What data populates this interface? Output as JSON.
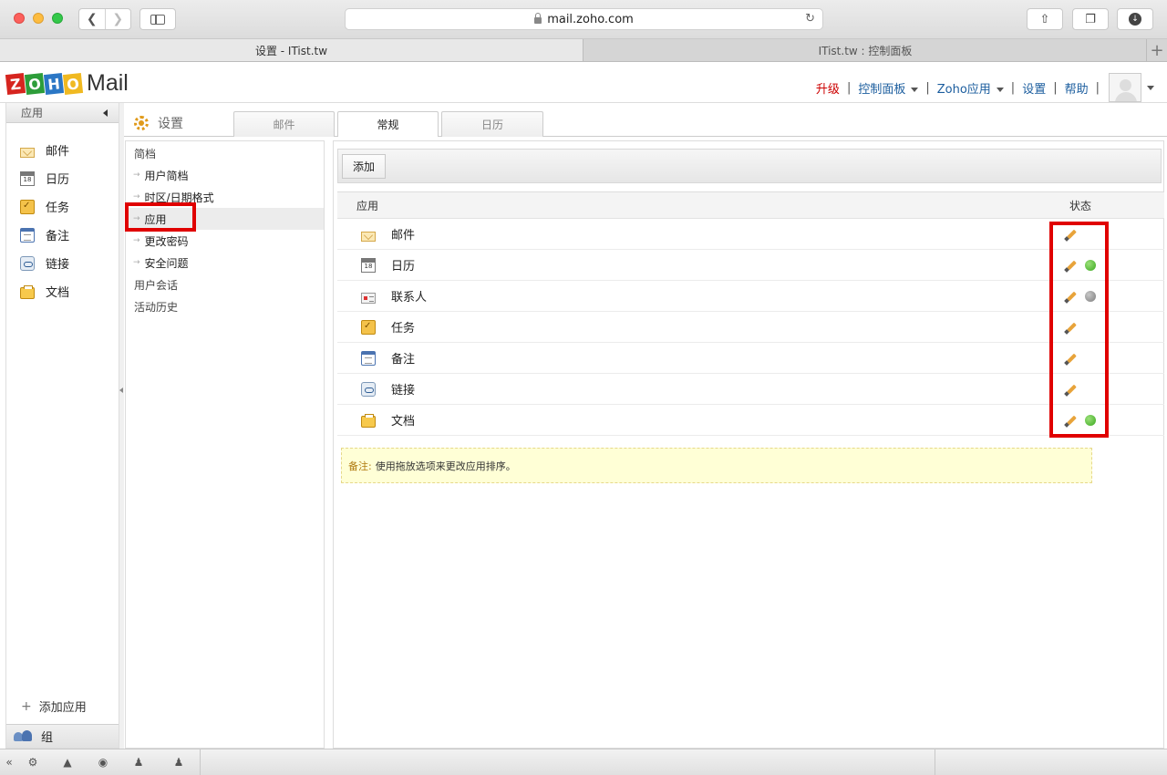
{
  "browser": {
    "url": "mail.zoho.com",
    "tabs": [
      {
        "label": "设置 - ITist.tw",
        "active": true
      },
      {
        "label": "ITist.tw : 控制面板",
        "active": false
      }
    ]
  },
  "header": {
    "logo_letters": [
      "Z",
      "O",
      "H",
      "O"
    ],
    "logo_colors": [
      "#d6251f",
      "#2d9d3a",
      "#2b77c5",
      "#f0b921"
    ],
    "logo_mail": "Mail",
    "nav": {
      "upgrade": "升级",
      "control_panel": "控制面板",
      "zoho_apps": "Zoho应用",
      "settings": "设置",
      "help": "帮助",
      "separator": "|"
    }
  },
  "left_sidebar": {
    "header": "应用",
    "items": [
      {
        "label": "邮件",
        "icon": "mail-icon"
      },
      {
        "label": "日历",
        "icon": "calendar-icon"
      },
      {
        "label": "任务",
        "icon": "tasks-icon"
      },
      {
        "label": "备注",
        "icon": "notes-icon"
      },
      {
        "label": "链接",
        "icon": "links-icon"
      },
      {
        "label": "文档",
        "icon": "docs-icon"
      }
    ],
    "add_app": "添加应用",
    "group": "组"
  },
  "settings": {
    "title": "设置",
    "tabs": [
      {
        "label": "邮件",
        "active": false
      },
      {
        "label": "常规",
        "active": true
      },
      {
        "label": "日历",
        "active": false
      }
    ],
    "menu": {
      "profile_header": "简档",
      "sub_items": [
        {
          "label": "用户简档",
          "selected": false
        },
        {
          "label": "时区/日期格式",
          "selected": false
        },
        {
          "label": "应用",
          "selected": true
        },
        {
          "label": "更改密码",
          "selected": false
        },
        {
          "label": "安全问题",
          "selected": false
        }
      ],
      "sessions": "用户会话",
      "activity_history": "活动历史"
    }
  },
  "main": {
    "add_button": "添加",
    "table": {
      "col_app": "应用",
      "col_status": "状态",
      "rows": [
        {
          "name": "邮件",
          "icon": "mail-icon",
          "status": "none"
        },
        {
          "name": "日历",
          "icon": "calendar-icon",
          "status": "green"
        },
        {
          "name": "联系人",
          "icon": "contacts-icon",
          "status": "grey"
        },
        {
          "name": "任务",
          "icon": "tasks-icon",
          "status": "none"
        },
        {
          "name": "备注",
          "icon": "notes-icon",
          "status": "none"
        },
        {
          "name": "链接",
          "icon": "links-icon",
          "status": "none"
        },
        {
          "name": "文档",
          "icon": "docs-icon",
          "status": "green"
        }
      ]
    },
    "note_label": "备注:",
    "note_text": "使用拖放选项来更改应用排序。"
  },
  "highlight_color": "#e00000"
}
